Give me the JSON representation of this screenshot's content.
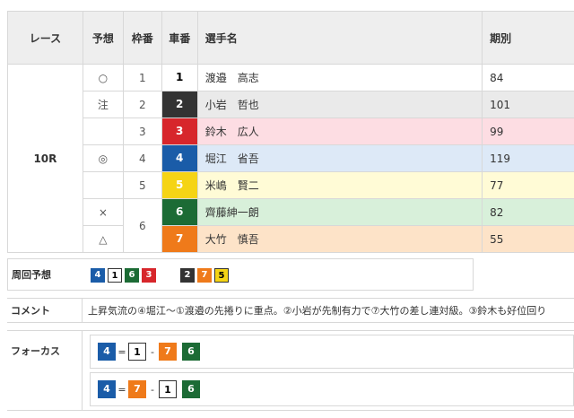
{
  "table": {
    "headers": {
      "race": "レース",
      "mark": "予想",
      "waku": "枠番",
      "car": "車番",
      "name": "選手名",
      "period": "期別"
    },
    "race_label": "10R",
    "rows": [
      {
        "mark": "○",
        "waku": "1",
        "car": "1",
        "name": "渡邉　高志",
        "period": "84",
        "car_color": "#ffffff"
      },
      {
        "mark": "注",
        "waku": "2",
        "car": "2",
        "name": "小岩　哲也",
        "period": "101",
        "car_color": "#333333"
      },
      {
        "mark": "",
        "waku": "3",
        "car": "3",
        "name": "鈴木　広人",
        "period": "99",
        "car_color": "#d7262b"
      },
      {
        "mark": "◎",
        "waku": "4",
        "car": "4",
        "name": "堀江　省吾",
        "period": "119",
        "car_color": "#1a5ca8"
      },
      {
        "mark": "",
        "waku": "5",
        "car": "5",
        "name": "米嶋　賢二",
        "period": "77",
        "car_color": "#f5d415"
      },
      {
        "mark": "×",
        "waku": "6",
        "car": "6",
        "name": "齊藤紳一朗",
        "period": "82",
        "car_color": "#1c6b35"
      },
      {
        "mark": "△",
        "waku": "",
        "car": "7",
        "name": "大竹　慎吾",
        "period": "55",
        "car_color": "#ef7a1a"
      }
    ]
  },
  "lap": {
    "label": "周回予想",
    "group1": [
      "4",
      "1",
      "6",
      "3"
    ],
    "group2": [
      "2",
      "7",
      "5"
    ]
  },
  "comment": {
    "label": "コメント",
    "text": "上昇気流の④堀江～①渡邉の先捲りに重点。②小岩が先制有力で⑦大竹の差し連対級。③鈴木も好位回り"
  },
  "focus": {
    "label": "フォーカス",
    "rows": [
      {
        "a": "4",
        "op1": "=",
        "b": "1",
        "op2": "-",
        "c": "7",
        "d": "6"
      },
      {
        "a": "4",
        "op1": "=",
        "b": "7",
        "op2": "-",
        "c": "1",
        "d": "6"
      }
    ]
  }
}
